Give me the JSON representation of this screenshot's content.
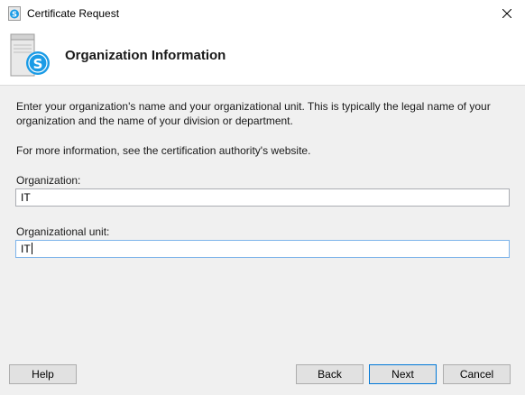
{
  "window": {
    "title": "Certificate Request",
    "close_icon": "close-icon"
  },
  "header": {
    "title": "Organization Information",
    "icon": "server-skype-icon"
  },
  "description": "Enter your organization's name and your organizational unit. This is typically the legal name of your organization and the name of your division or department.",
  "more_info": "For more information, see the certification authority's website.",
  "fields": {
    "organization": {
      "label": "Organization:",
      "value": "IT"
    },
    "organizational_unit": {
      "label": "Organizational unit:",
      "value": "IT"
    }
  },
  "buttons": {
    "help": "Help",
    "back": "Back",
    "next": "Next",
    "cancel": "Cancel"
  },
  "colors": {
    "accent": "#0078d7",
    "skype_blue": "#1a9be6"
  }
}
